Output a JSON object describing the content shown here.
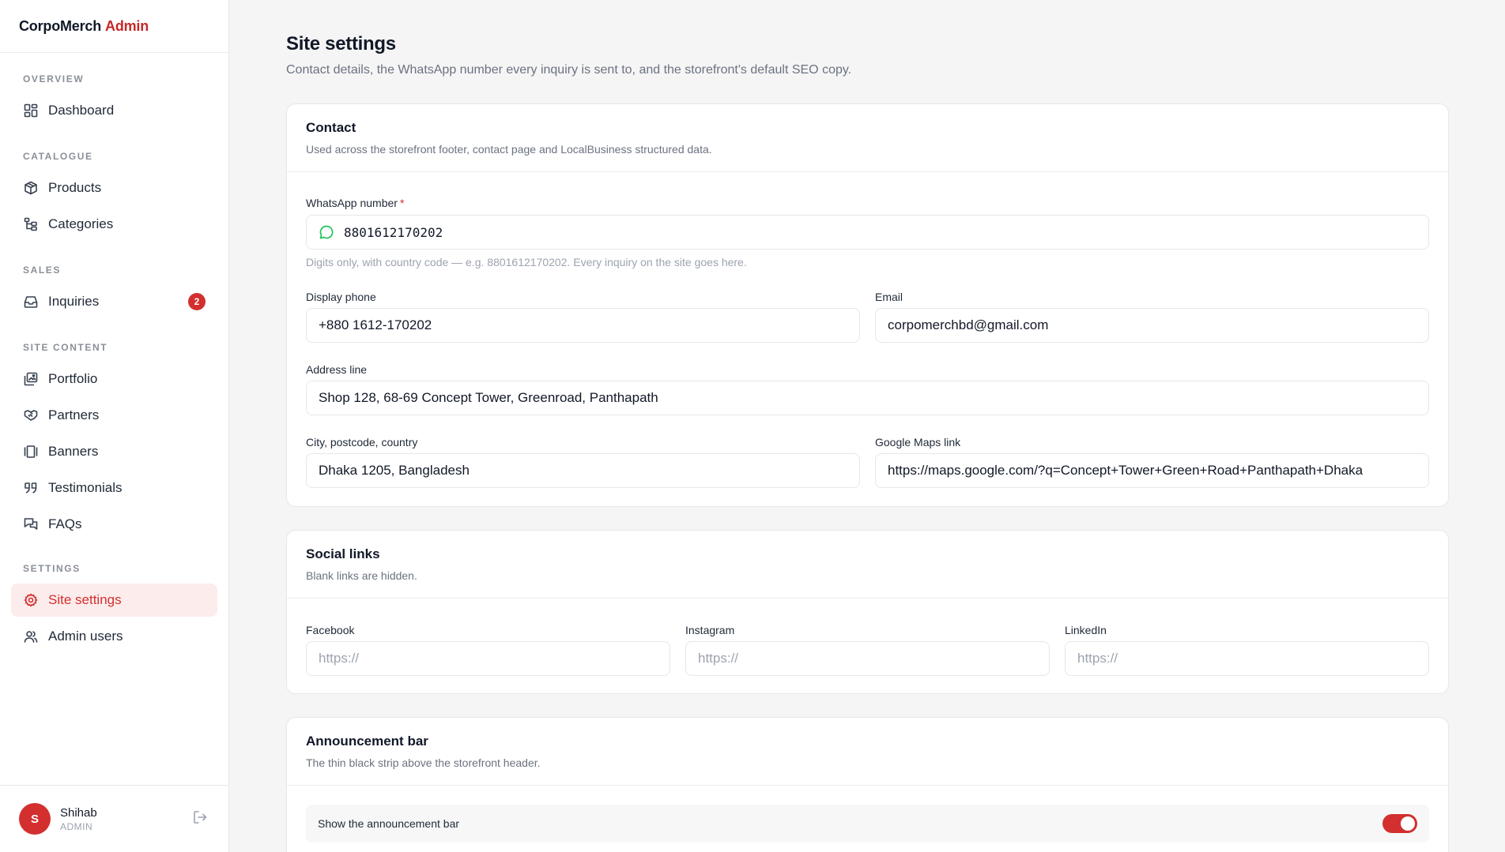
{
  "brand": {
    "name": "CorpoMerch",
    "suffix": "Admin",
    "accent_color": "#c62828"
  },
  "sidebar": {
    "sections": [
      {
        "heading": "OVERVIEW",
        "items": [
          {
            "label": "Dashboard",
            "icon": "dashboard-icon"
          }
        ]
      },
      {
        "heading": "CATALOGUE",
        "items": [
          {
            "label": "Products",
            "icon": "box-icon"
          },
          {
            "label": "Categories",
            "icon": "categories-tree-icon"
          }
        ]
      },
      {
        "heading": "SALES",
        "items": [
          {
            "label": "Inquiries",
            "icon": "inbox-icon",
            "badge": "2"
          }
        ]
      },
      {
        "heading": "SITE CONTENT",
        "items": [
          {
            "label": "Portfolio",
            "icon": "portfolio-icon"
          },
          {
            "label": "Partners",
            "icon": "handshake-icon"
          },
          {
            "label": "Banners",
            "icon": "banner-icon"
          },
          {
            "label": "Testimonials",
            "icon": "quote-icon"
          },
          {
            "label": "FAQs",
            "icon": "faq-icon"
          }
        ]
      },
      {
        "heading": "SETTINGS",
        "items": [
          {
            "label": "Site settings",
            "icon": "gear-icon",
            "active": true
          },
          {
            "label": "Admin users",
            "icon": "users-icon"
          }
        ]
      }
    ],
    "badge_color": "#d32f2f",
    "user": {
      "initial": "S",
      "name": "Shihab",
      "role": "ADMIN",
      "avatar_color": "#d32f2f"
    }
  },
  "page": {
    "title": "Site settings",
    "subtitle": "Contact details, the WhatsApp number every inquiry is sent to, and the storefront's default SEO copy."
  },
  "contact": {
    "title": "Contact",
    "description": "Used across the storefront footer, contact page and LocalBusiness structured data.",
    "whatsapp_label": "WhatsApp number",
    "required_mark": "*",
    "whatsapp_value": "8801612170202",
    "whatsapp_hint": "Digits only, with country code — e.g. 8801612170202. Every inquiry on the site goes here.",
    "phone_label": "Display phone",
    "phone_value": "+880 1612-170202",
    "email_label": "Email",
    "email_value": "corpomerchbd@gmail.com",
    "address_label": "Address line",
    "address_value": "Shop 128, 68-69 Concept Tower, Greenroad, Panthapath",
    "city_label": "City, postcode, country",
    "city_value": "Dhaka 1205, Bangladesh",
    "maps_label": "Google Maps link",
    "maps_value": "https://maps.google.com/?q=Concept+Tower+Green+Road+Panthapath+Dhaka",
    "whatsapp_icon_color": "#22c55e"
  },
  "social": {
    "title": "Social links",
    "description": "Blank links are hidden.",
    "facebook_label": "Facebook",
    "instagram_label": "Instagram",
    "linkedin_label": "LinkedIn",
    "placeholder": "https://"
  },
  "announcement": {
    "title": "Announcement bar",
    "description": "The thin black strip above the storefront header.",
    "toggle_label": "Show the announcement bar",
    "enabled": true,
    "toggle_color": "#d32f2f"
  }
}
